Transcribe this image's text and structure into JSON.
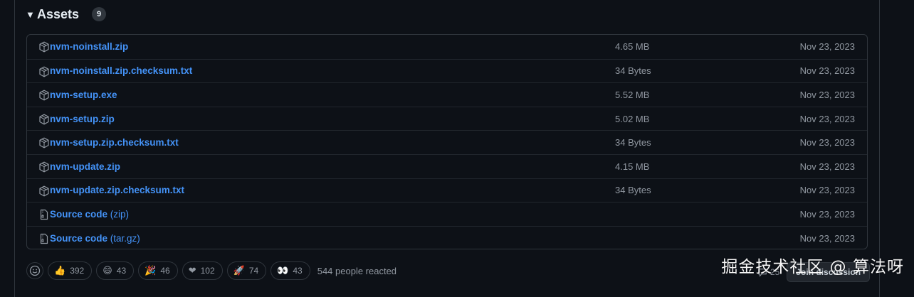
{
  "assets": {
    "title": "Assets",
    "count": "9",
    "items": [
      {
        "name": "nvm-noinstall.zip",
        "suffix": "",
        "size": "4.65 MB",
        "date": "Nov 23, 2023",
        "icon": "package-icon"
      },
      {
        "name": "nvm-noinstall.zip.checksum.txt",
        "suffix": "",
        "size": "34 Bytes",
        "date": "Nov 23, 2023",
        "icon": "package-icon"
      },
      {
        "name": "nvm-setup.exe",
        "suffix": "",
        "size": "5.52 MB",
        "date": "Nov 23, 2023",
        "icon": "package-icon"
      },
      {
        "name": "nvm-setup.zip",
        "suffix": "",
        "size": "5.02 MB",
        "date": "Nov 23, 2023",
        "icon": "package-icon"
      },
      {
        "name": "nvm-setup.zip.checksum.txt",
        "suffix": "",
        "size": "34 Bytes",
        "date": "Nov 23, 2023",
        "icon": "package-icon"
      },
      {
        "name": "nvm-update.zip",
        "suffix": "",
        "size": "4.15 MB",
        "date": "Nov 23, 2023",
        "icon": "package-icon"
      },
      {
        "name": "nvm-update.zip.checksum.txt",
        "suffix": "",
        "size": "34 Bytes",
        "date": "Nov 23, 2023",
        "icon": "package-icon"
      },
      {
        "name": "Source code",
        "suffix": " (zip)",
        "size": "",
        "date": "Nov 23, 2023",
        "icon": "file-zip-icon"
      },
      {
        "name": "Source code",
        "suffix": " (tar.gz)",
        "size": "",
        "date": "Nov 23, 2023",
        "icon": "file-zip-icon"
      }
    ]
  },
  "reactions": {
    "items": [
      {
        "emoji": "👍",
        "count": "392",
        "icon": "thumbs-up-icon"
      },
      {
        "emoji": "😄",
        "count": "43",
        "icon": "laugh-icon"
      },
      {
        "emoji": "🎉",
        "count": "46",
        "icon": "hooray-icon"
      },
      {
        "emoji": "❤",
        "count": "102",
        "icon": "heart-icon"
      },
      {
        "emoji": "🚀",
        "count": "74",
        "icon": "rocket-icon"
      },
      {
        "emoji": "👀",
        "count": "43",
        "icon": "eyes-icon"
      }
    ],
    "summary": "544 people reacted"
  },
  "discussion": {
    "comment_count": "25",
    "join_label": "Join discussion"
  },
  "watermark": "掘金技术社区 @ 算法呀",
  "colors": {
    "background": "#0d1117",
    "link": "#4493f8",
    "muted": "#9198a1",
    "border": "#30363d"
  }
}
